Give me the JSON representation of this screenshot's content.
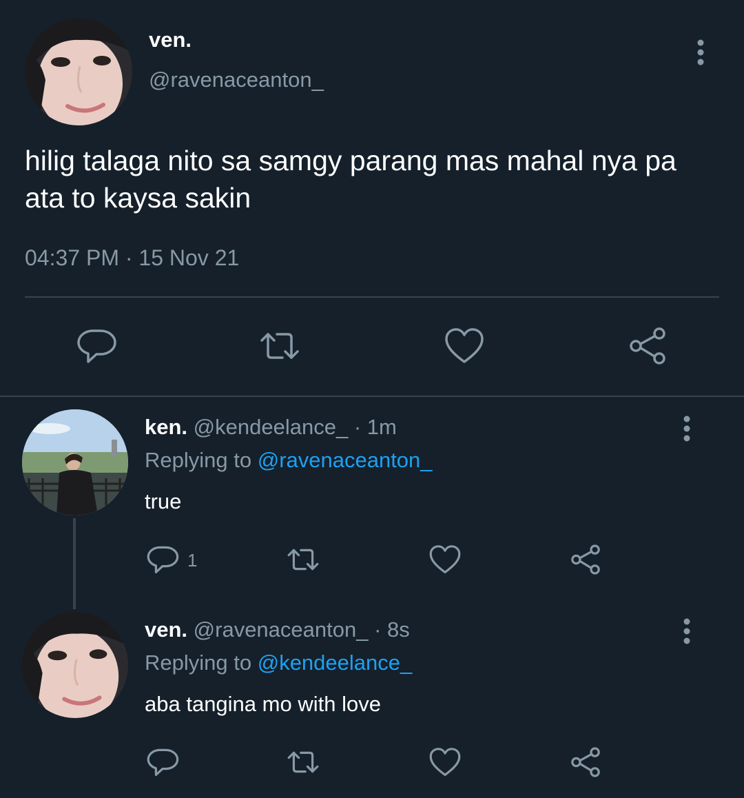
{
  "main_tweet": {
    "display_name": "ven.",
    "handle": "@ravenaceanton_",
    "text": "hilig talaga nito sa samgy parang mas mahal nya pa ata to kaysa sakin",
    "time": "04:37 PM",
    "separator": "·",
    "date": "15 Nov 21",
    "actions": [
      "reply-icon",
      "retweet-icon",
      "like-icon",
      "share-icon"
    ]
  },
  "replies": [
    {
      "display_name": "ken.",
      "handle": "@kendeelance_",
      "separator": "·",
      "time_ago": "1m",
      "replying_prefix": "Replying to",
      "replying_to": "@ravenaceanton_",
      "text": "true",
      "reply_count": "1"
    },
    {
      "display_name": "ven.",
      "handle": "@ravenaceanton_",
      "separator": "·",
      "time_ago": "8s",
      "replying_prefix": "Replying to",
      "replying_to": "@kendeelance_",
      "text": "aba tangina mo with love",
      "reply_count": ""
    }
  ],
  "colors": {
    "background": "#15202b",
    "secondary_text": "#8899a6",
    "accent": "#1da1f2",
    "divider": "#38444d"
  }
}
